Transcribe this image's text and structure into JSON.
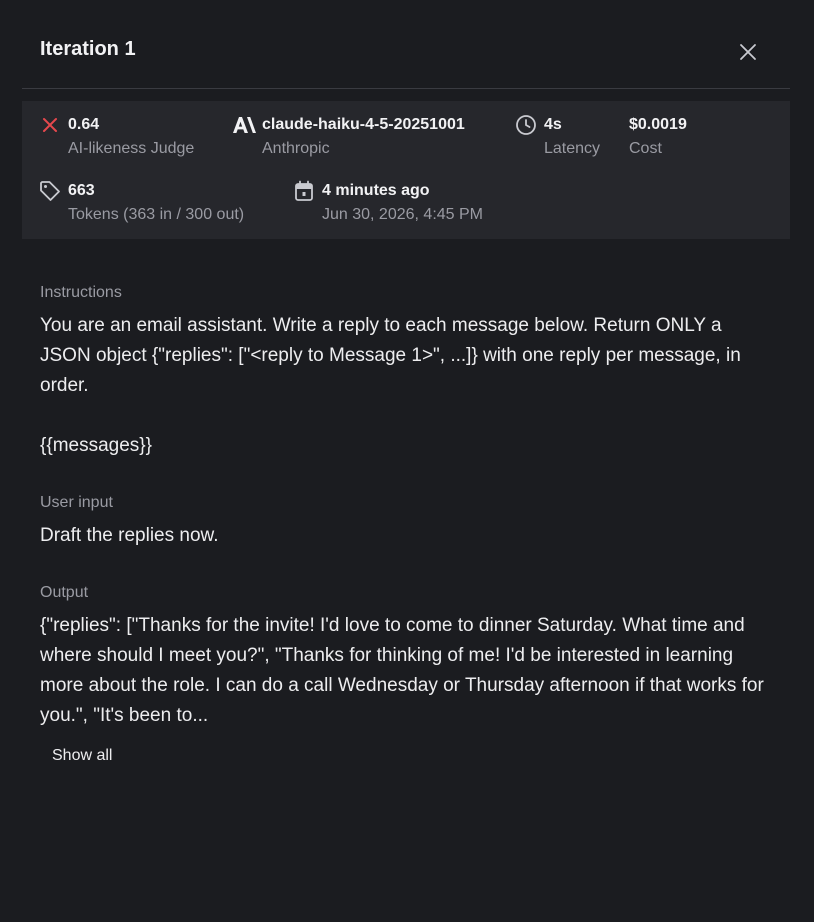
{
  "title": "Iteration 1",
  "meta": {
    "score": {
      "value": "0.64",
      "label": "AI-likeness Judge",
      "status_color": "#e5484d"
    },
    "model": {
      "value": "claude-haiku-4-5-20251001",
      "label": "Anthropic"
    },
    "latency": {
      "value": "4s",
      "label": "Latency"
    },
    "cost": {
      "value": "$0.0019",
      "label": "Cost"
    },
    "tokens": {
      "value": "663",
      "label": "Tokens (363 in / 300 out)"
    },
    "time": {
      "value": "4 minutes ago",
      "label": "Jun 30, 2026, 4:45 PM"
    }
  },
  "instructions": {
    "label": "Instructions",
    "text": "You are an email assistant. Write a reply to each message below. Return ONLY a JSON object {\"replies\": [\"<reply to Message 1>\", ...]} with one reply per message, in order.\n\n{{messages}}"
  },
  "user_input": {
    "label": "User input",
    "text": "Draft the replies now."
  },
  "output": {
    "label": "Output",
    "text": "{\"replies\": [\"Thanks for the invite! I'd love to come to dinner Saturday. What time and where should I meet you?\", \"Thanks for thinking of me! I'd be interested in learning more about the role. I can do a call Wednesday or Thursday afternoon if that works for you.\", \"It's been to...",
    "show_all_label": "Show all"
  },
  "icons": {
    "close": "close-icon",
    "score": "x-mark-icon",
    "model": "anthropic-logo-icon",
    "latency": "clock-icon",
    "tokens": "tag-icon",
    "time": "calendar-icon"
  }
}
